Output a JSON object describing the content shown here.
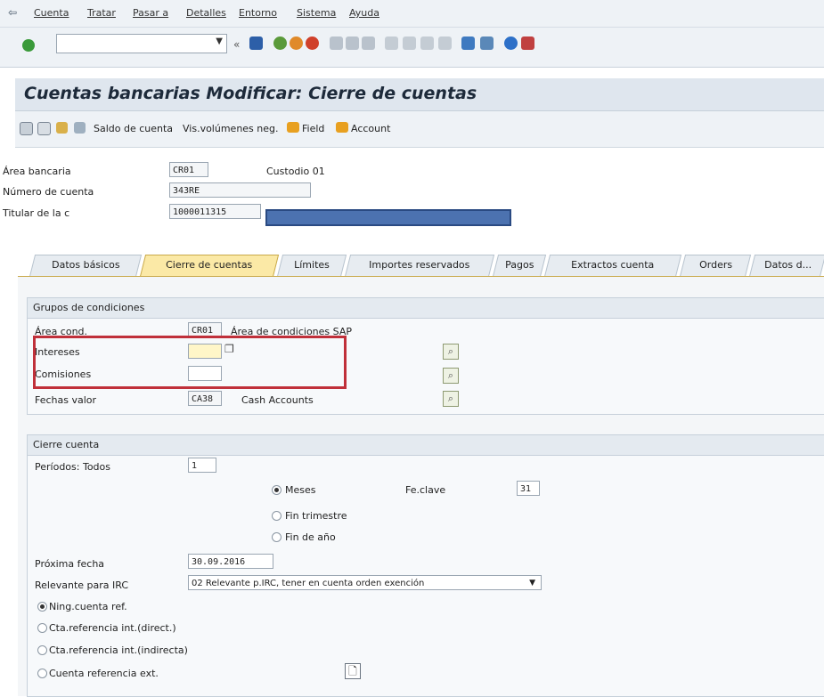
{
  "menu": [
    "Cuenta",
    "Tratar",
    "Pasar a",
    "Detalles",
    "Entorno",
    "Sistema",
    "Ayuda"
  ],
  "title": "Cuentas bancarias Modificar: Cierre de cuentas",
  "app_toolbar": {
    "saldo": "Saldo de cuenta",
    "volumenes": "Vis.volúmenes neg.",
    "field": "Field",
    "account": "Account"
  },
  "header": {
    "area_label": "Área bancaria",
    "area_value": "CR01",
    "area_text": "Custodio 01",
    "numero_label": "Número de cuenta",
    "numero_value": "343RE",
    "titular_label": "Titular de la c",
    "titular_value": "1000011315"
  },
  "tabs": [
    "Datos básicos",
    "Cierre de cuentas",
    "Límites",
    "Importes reservados",
    "Pagos",
    "Extractos cuenta",
    "Orders",
    "Datos d..."
  ],
  "grupos": {
    "heading": "Grupos de condiciones",
    "area_cond_label": "Área cond.",
    "area_cond_value": "CR01",
    "area_cond_text": "Área de condiciones SAP",
    "intereses_label": "Intereses",
    "comisiones_label": "Comisiones",
    "fechas_label": "Fechas valor",
    "fechas_value": "CA38",
    "fechas_text": "Cash Accounts"
  },
  "cierre": {
    "heading": "Cierre cuenta",
    "periodos_label": "Períodos: Todos",
    "periodos_value": "1",
    "meses": "Meses",
    "fin_trimestre": "Fin trimestre",
    "fin_anio": "Fin de año",
    "feclave_label": "Fe.clave",
    "feclave_value": "31",
    "proxima_label": "Próxima fecha",
    "proxima_value": "30.09.2016",
    "irc_label": "Relevante para IRC",
    "irc_value": "02 Relevante p.IRC, tener en cuenta orden exención",
    "ning": "Ning.cuenta ref.",
    "direct": "Cta.referencia int.(direct.)",
    "indirect": "Cta.referencia int.(indirecta)",
    "ext": "Cuenta referencia ext."
  },
  "colors": {
    "accent_tab": "#fbe9a6",
    "highlight": "#c0303a",
    "redaction": "#4c72b0"
  }
}
